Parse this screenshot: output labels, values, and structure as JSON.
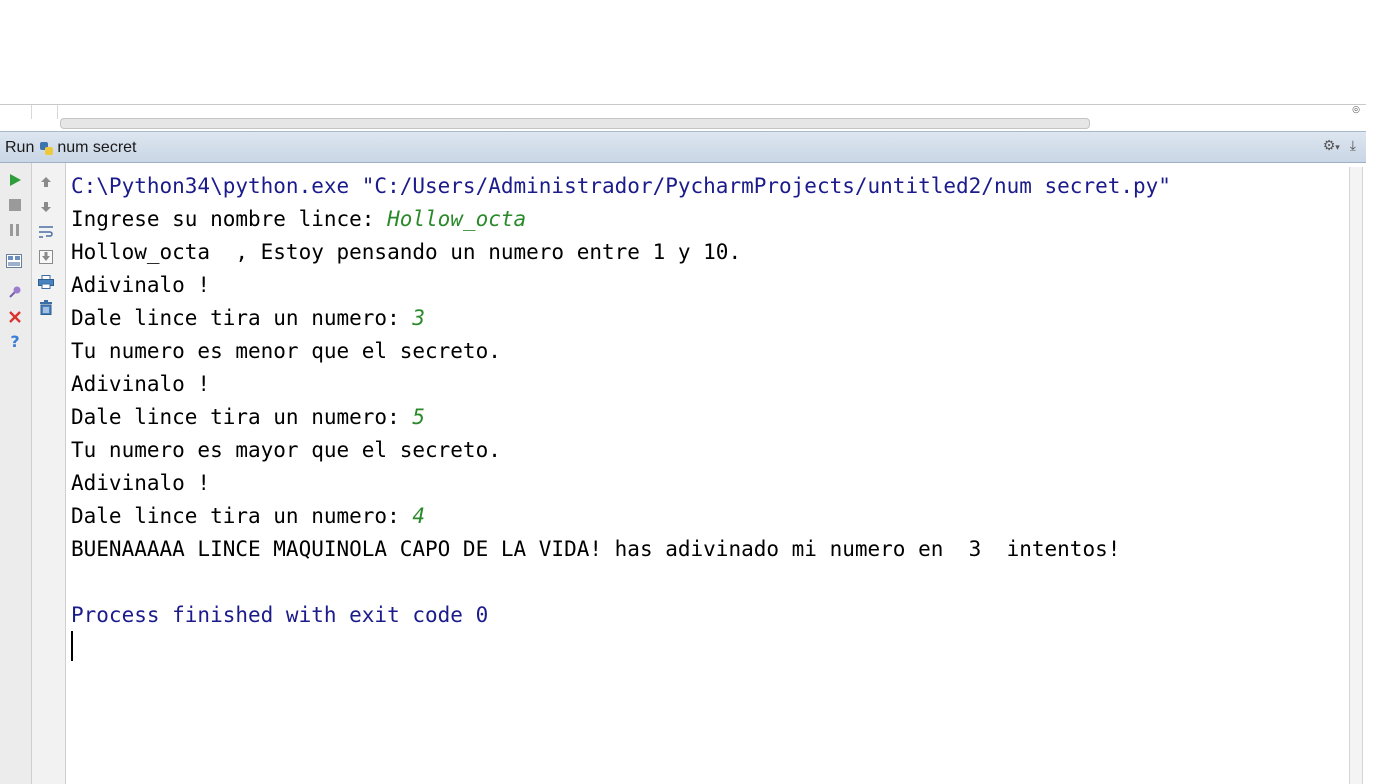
{
  "run_panel": {
    "tab_label": "Run",
    "config_name": "num secret"
  },
  "toolbar_icons": {
    "left": [
      "run-icon",
      "stop-icon",
      "pause-icon",
      "layout-icon",
      "pin-icon",
      "close-icon",
      "help-icon"
    ],
    "right": [
      "scroll-up-icon",
      "scroll-down-icon",
      "soft-wrap-icon",
      "scroll-to-end-icon",
      "print-icon",
      "clear-all-icon"
    ],
    "header_right": [
      "gear-icon",
      "hide-icon"
    ]
  },
  "console": {
    "lines": [
      {
        "parts": [
          {
            "text": "C:\\Python34\\python.exe \"C:/Users/Administrador/PycharmProjects/untitled2/num secret.py\"",
            "kind": "sys"
          }
        ]
      },
      {
        "parts": [
          {
            "text": "Ingrese su nombre lince: ",
            "kind": "out"
          },
          {
            "text": "Hollow_octa",
            "kind": "inp"
          }
        ]
      },
      {
        "parts": [
          {
            "text": "Hollow_octa  , Estoy pensando un numero entre 1 y 10.",
            "kind": "out"
          }
        ]
      },
      {
        "parts": [
          {
            "text": "Adivinalo !",
            "kind": "out"
          }
        ]
      },
      {
        "parts": [
          {
            "text": "Dale lince tira un numero: ",
            "kind": "out"
          },
          {
            "text": "3",
            "kind": "inp"
          }
        ]
      },
      {
        "parts": [
          {
            "text": "Tu numero es menor que el secreto.",
            "kind": "out"
          }
        ]
      },
      {
        "parts": [
          {
            "text": "Adivinalo !",
            "kind": "out"
          }
        ]
      },
      {
        "parts": [
          {
            "text": "Dale lince tira un numero: ",
            "kind": "out"
          },
          {
            "text": "5",
            "kind": "inp"
          }
        ]
      },
      {
        "parts": [
          {
            "text": "Tu numero es mayor que el secreto.",
            "kind": "out"
          }
        ]
      },
      {
        "parts": [
          {
            "text": "Adivinalo !",
            "kind": "out"
          }
        ]
      },
      {
        "parts": [
          {
            "text": "Dale lince tira un numero: ",
            "kind": "out"
          },
          {
            "text": "4",
            "kind": "inp"
          }
        ]
      },
      {
        "parts": [
          {
            "text": "BUENAAAAA LINCE MAQUINOLA CAPO DE LA VIDA! has adivinado mi numero en  3  intentos!",
            "kind": "out"
          }
        ]
      },
      {
        "parts": [
          {
            "text": "",
            "kind": "out"
          }
        ]
      },
      {
        "parts": [
          {
            "text": "Process finished with exit code 0",
            "kind": "sys"
          }
        ]
      }
    ]
  },
  "colors": {
    "system_text": "#1b1b8c",
    "user_input": "#2a8a2a",
    "output_text": "#000000",
    "run_green": "#2e9e3a",
    "close_red": "#d9342b",
    "help_blue": "#3a7fd5"
  }
}
